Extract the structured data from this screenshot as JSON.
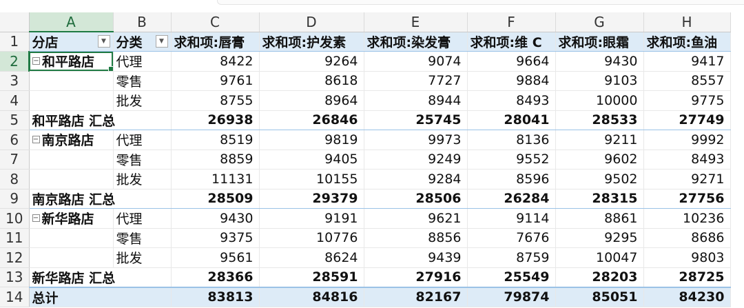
{
  "columns": [
    "A",
    "B",
    "C",
    "D",
    "E",
    "F",
    "G",
    "H"
  ],
  "rows": [
    "1",
    "2",
    "3",
    "4",
    "5",
    "6",
    "7",
    "8",
    "9",
    "10",
    "11",
    "12",
    "13",
    "14"
  ],
  "header": [
    "分店",
    "分类",
    "求和项:唇膏",
    "求和项:护发素",
    "求和项:染发膏",
    "求和项:维 C",
    "求和项:眼霜",
    "求和项:鱼油"
  ],
  "groups": [
    {
      "store": "和平路店",
      "items": [
        {
          "cat": "代理",
          "vals": [
            "8422",
            "9264",
            "9074",
            "9664",
            "9430",
            "9417"
          ]
        },
        {
          "cat": "零售",
          "vals": [
            "9761",
            "8618",
            "7727",
            "9884",
            "9103",
            "8557"
          ]
        },
        {
          "cat": "批发",
          "vals": [
            "8755",
            "8964",
            "8944",
            "8493",
            "10000",
            "9775"
          ]
        }
      ],
      "subtotal_label": "和平路店 汇总",
      "subtotal": [
        "26938",
        "26846",
        "25745",
        "28041",
        "28533",
        "27749"
      ]
    },
    {
      "store": "南京路店",
      "items": [
        {
          "cat": "代理",
          "vals": [
            "8519",
            "9819",
            "9973",
            "8136",
            "9211",
            "9992"
          ]
        },
        {
          "cat": "零售",
          "vals": [
            "8859",
            "9405",
            "9249",
            "9552",
            "9602",
            "8493"
          ]
        },
        {
          "cat": "批发",
          "vals": [
            "11131",
            "10155",
            "9284",
            "8596",
            "9502",
            "9271"
          ]
        }
      ],
      "subtotal_label": "南京路店 汇总",
      "subtotal": [
        "28509",
        "29379",
        "28506",
        "26284",
        "28315",
        "27756"
      ]
    },
    {
      "store": "新华路店",
      "items": [
        {
          "cat": "代理",
          "vals": [
            "9430",
            "9191",
            "9621",
            "9114",
            "8861",
            "10236"
          ]
        },
        {
          "cat": "零售",
          "vals": [
            "9375",
            "10776",
            "8856",
            "7676",
            "9295",
            "8686"
          ]
        },
        {
          "cat": "批发",
          "vals": [
            "9561",
            "8624",
            "9439",
            "8759",
            "10047",
            "9803"
          ]
        }
      ],
      "subtotal_label": "新华路店 汇总",
      "subtotal": [
        "28366",
        "28591",
        "27916",
        "25549",
        "28203",
        "28725"
      ]
    }
  ],
  "grand_label": "总计",
  "grand": [
    "83813",
    "84816",
    "82167",
    "79874",
    "85051",
    "84230"
  ],
  "icons": {
    "dropdown": "dropdown-arrow-icon",
    "collapse": "collapse-minus-icon"
  },
  "colors": {
    "header_fill": "#ddebf7",
    "border_blue": "#9bc2e6",
    "selection_green": "#1f7a43"
  }
}
